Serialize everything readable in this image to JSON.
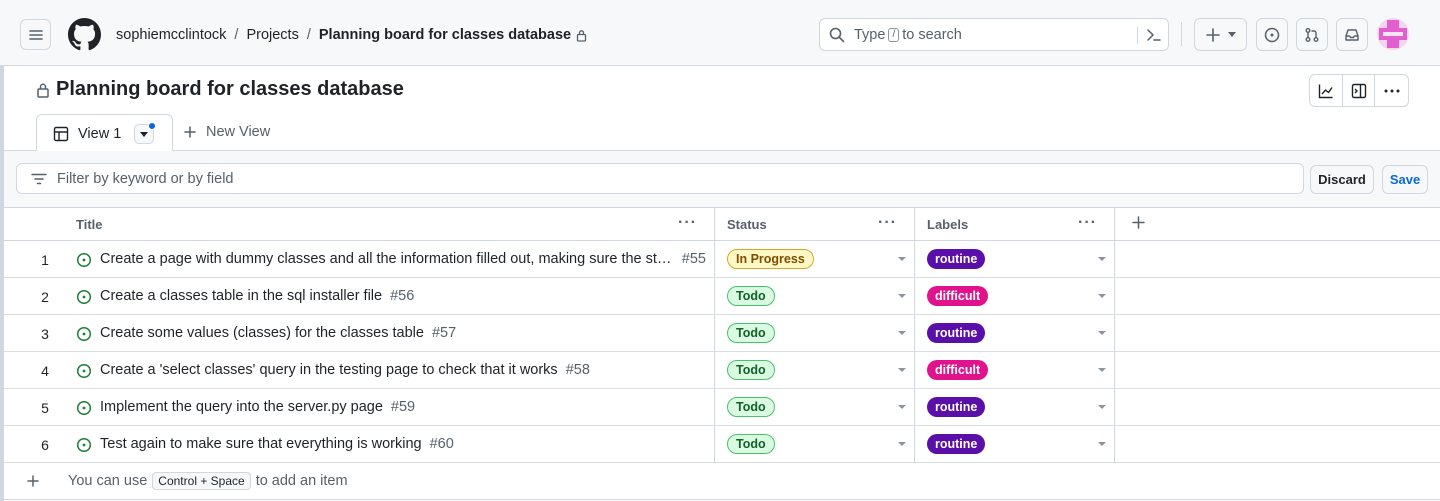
{
  "header": {
    "crumbs": {
      "owner": "sophiemcclintock",
      "section": "Projects",
      "project": "Planning board for classes database"
    },
    "search": {
      "before": "Type",
      "key": "/",
      "after": "to search"
    }
  },
  "project": {
    "title": "Planning board for classes database",
    "tabs": [
      {
        "label": "View 1"
      }
    ],
    "new_view_label": "New View"
  },
  "filter": {
    "placeholder": "Filter by keyword or by field",
    "discard_label": "Discard",
    "save_label": "Save"
  },
  "table": {
    "columns": {
      "title": "Title",
      "status": "Status",
      "labels": "Labels"
    },
    "rows": [
      {
        "n": "1",
        "title": "Create a page with dummy classes and all the information filled out, making sure the styling is consistent",
        "number": "#55",
        "status": "In Progress",
        "label": "routine"
      },
      {
        "n": "2",
        "title": "Create a classes table in the sql installer file",
        "number": "#56",
        "status": "Todo",
        "label": "difficult"
      },
      {
        "n": "3",
        "title": "Create some values (classes) for the classes table",
        "number": "#57",
        "status": "Todo",
        "label": "routine"
      },
      {
        "n": "4",
        "title": "Create a 'select classes' query in the testing page to check that it works",
        "number": "#58",
        "status": "Todo",
        "label": "difficult"
      },
      {
        "n": "5",
        "title": "Implement the query into the server.py page",
        "number": "#59",
        "status": "Todo",
        "label": "routine"
      },
      {
        "n": "6",
        "title": "Test again to make sure that everything is working",
        "number": "#60",
        "status": "Todo",
        "label": "routine"
      }
    ],
    "footer": {
      "before": "You can use",
      "key": "Control + Space",
      "after": "to add an item"
    }
  },
  "colors": {
    "status_in_progress_bg": "#fff8c5",
    "status_in_progress_fg": "#7d4e00",
    "status_in_progress_border": "#d4a72c",
    "status_todo_bg": "#dafbe1",
    "status_todo_fg": "#116329",
    "status_todo_border": "#4ac26b",
    "label_routine": "#5a0fa8",
    "label_difficult": "#e0138d",
    "issue_open": "#1a7f37",
    "accent": "#0969da"
  }
}
